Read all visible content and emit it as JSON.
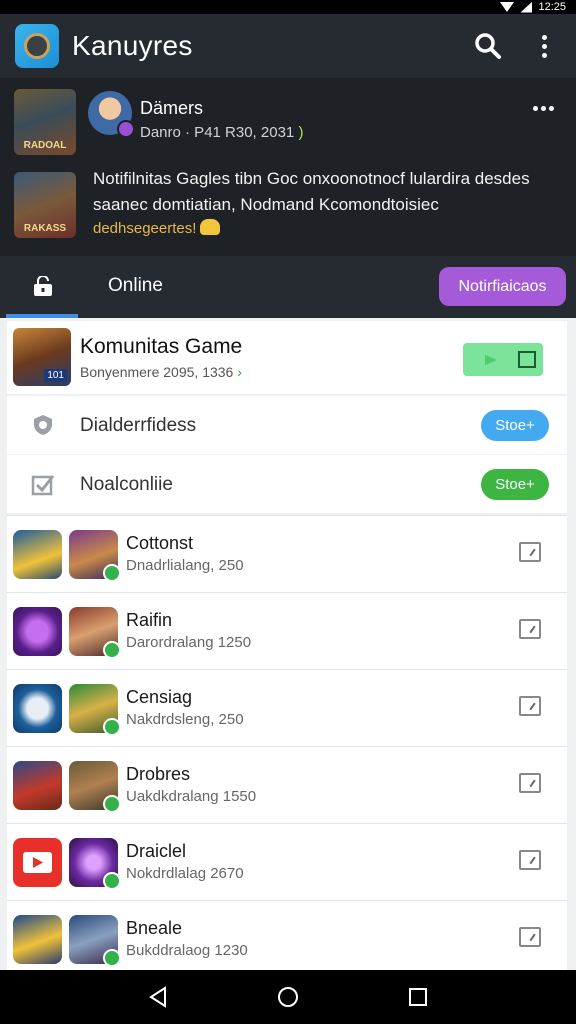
{
  "status_bar": {
    "time": "12:25"
  },
  "app_bar": {
    "title": "Kanuyres"
  },
  "header": {
    "name": "Dämers",
    "meta": "Danro · P41 R30, 2031",
    "meta_accent": ")",
    "description": "Notifilnitas Gagles tibn Goc onxoonotnocf lulardira desdes saanec domtiatian, Nodmand Kcomondtoisiec",
    "tag": "dedhsegeertes!",
    "thumb_captions": [
      "RADOAL",
      "RAKASS"
    ]
  },
  "tabs": {
    "online_label": "Online",
    "notifications_button": "Notirfiaicaos"
  },
  "community": {
    "title": "Komunitas Game",
    "subtitle": "Bonyenmere 2095, 1336",
    "subtitle_accent": "›",
    "thumb_badge": "101"
  },
  "settings": [
    {
      "label": "Dialderrfidess",
      "button": "Stoe+"
    },
    {
      "label": "Noalconliie",
      "button": "Stoe+"
    }
  ],
  "list": [
    {
      "title": "Cottonst",
      "meta": "Dnadrlialang, 250"
    },
    {
      "title": "Raifin",
      "meta": "Darordralang 1250"
    },
    {
      "title": "Censiag",
      "meta": "Nakdrdsleng, 250"
    },
    {
      "title": "Drobres",
      "meta": "Uakdkdralang 1550"
    },
    {
      "title": "Draiclel",
      "meta": "Nokdrdlalag 2670"
    },
    {
      "title": "Bneale",
      "meta": "Bukddralaog 1230"
    }
  ],
  "colors": {
    "accent_purple": "#a55bd9",
    "accent_blue": "#44aaf0",
    "accent_green": "#3cb543",
    "header_bg": "#1e2226"
  },
  "icons": {
    "app_bar": [
      "app-logo-icon",
      "search-icon",
      "more-vert-icon"
    ],
    "nav": [
      "back-icon",
      "home-icon",
      "recents-icon"
    ]
  }
}
